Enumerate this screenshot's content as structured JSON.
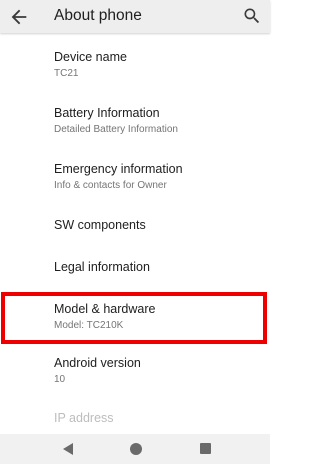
{
  "app_bar": {
    "title": "About phone",
    "back_icon": "arrow-back-icon",
    "search_icon": "search-icon"
  },
  "items": [
    {
      "primary": "Device name",
      "secondary": "TC21"
    },
    {
      "primary": "Battery Information",
      "secondary": "Detailed Battery Information"
    },
    {
      "primary": "Emergency information",
      "secondary": "Info & contacts for Owner"
    },
    {
      "primary": "SW components",
      "secondary": ""
    },
    {
      "primary": "Legal information",
      "secondary": ""
    },
    {
      "primary": "Model & hardware",
      "secondary": "Model: TC210K"
    },
    {
      "primary": "Android version",
      "secondary": "10"
    },
    {
      "primary": "IP address",
      "secondary": ""
    }
  ],
  "highlight": {
    "color": "#ee0000",
    "target": "Model & hardware"
  },
  "nav_bar": {
    "back_icon": "triangle-back-icon",
    "home_icon": "circle-home-icon",
    "recents_icon": "square-recents-icon"
  }
}
